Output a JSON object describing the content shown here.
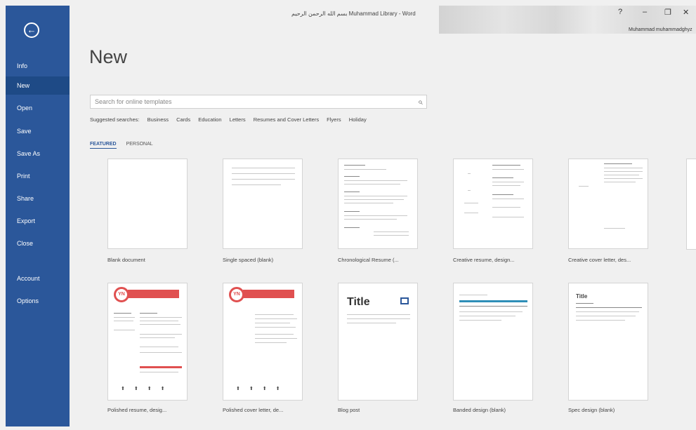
{
  "window": {
    "title": "بسم الله الرحمن الرحيم Muhammad Library - Word",
    "username": "Muhammad muhammadghyz",
    "controls": [
      "?",
      "–",
      "❐",
      "✕"
    ]
  },
  "backstage": {
    "back_icon": "back-arrow-icon",
    "items": [
      {
        "label": "Info"
      },
      {
        "label": "New",
        "active": true
      },
      {
        "label": "Open"
      },
      {
        "label": "Save"
      },
      {
        "label": "Save As"
      },
      {
        "label": "Print"
      },
      {
        "label": "Share"
      },
      {
        "label": "Export"
      },
      {
        "label": "Close"
      },
      {
        "label": "Account"
      },
      {
        "label": "Options"
      }
    ]
  },
  "page": {
    "title": "New",
    "search_placeholder": "Search for online templates",
    "suggested": [
      "Suggested searches:",
      "Business",
      "Cards",
      "Education",
      "Letters",
      "Resumes and Cover Letters",
      "Flyers",
      "Holiday"
    ],
    "tabs": [
      "FEATURED",
      "PERSONAL"
    ]
  },
  "templates": [
    {
      "label": "Blank document"
    },
    {
      "label": "Single spaced (blank)"
    },
    {
      "label": "Chronological Resume (..."
    },
    {
      "label": "Creative resume, design..."
    },
    {
      "label": "Creative cover letter, des..."
    },
    {
      "label": "Polished resume, desig...",
      "badge": "YN"
    },
    {
      "label": "Polished cover letter, de...",
      "badge": "YN"
    },
    {
      "label": "Blog post",
      "heading": "Title"
    },
    {
      "label": "Banded design (blank)"
    },
    {
      "label": "Spec design (blank)",
      "heading": "Title"
    }
  ],
  "colors": {
    "accent": "#2b579a",
    "resume_red": "#e05050",
    "banded_blue": "#2f8fb8"
  }
}
